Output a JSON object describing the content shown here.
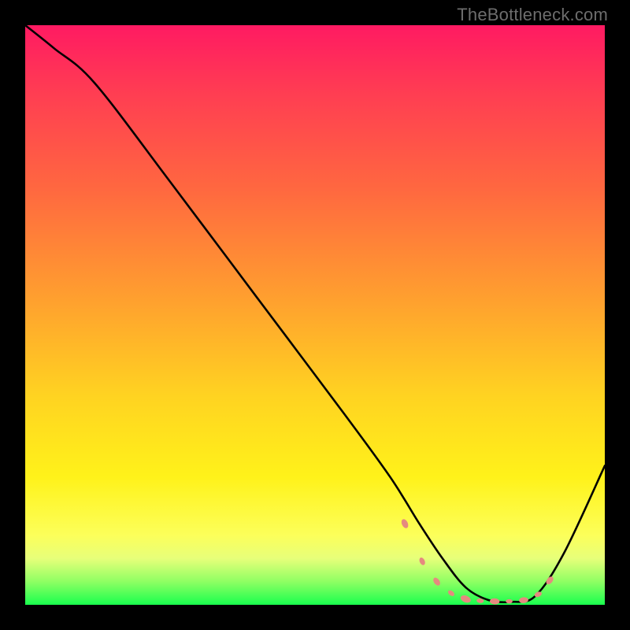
{
  "watermark": "TheBottleneck.com",
  "chart_data": {
    "type": "line",
    "title": "",
    "xlabel": "",
    "ylabel": "",
    "xlim": [
      0,
      100
    ],
    "ylim": [
      0,
      100
    ],
    "grid": false,
    "legend": false,
    "background": {
      "type": "vertical-gradient",
      "stops": [
        {
          "pos": 0,
          "color": "#ff1a62"
        },
        {
          "pos": 12,
          "color": "#ff3e52"
        },
        {
          "pos": 28,
          "color": "#ff6740"
        },
        {
          "pos": 48,
          "color": "#ffa22e"
        },
        {
          "pos": 64,
          "color": "#ffd321"
        },
        {
          "pos": 78,
          "color": "#fff21a"
        },
        {
          "pos": 88,
          "color": "#fcff5a"
        },
        {
          "pos": 92,
          "color": "#e7ff7a"
        },
        {
          "pos": 96,
          "color": "#8fff63"
        },
        {
          "pos": 100,
          "color": "#19ff4e"
        }
      ]
    },
    "series": [
      {
        "name": "bottleneck-curve",
        "color": "#000000",
        "x": [
          0,
          5,
          12,
          25,
          40,
          55,
          63,
          68,
          72,
          76,
          80,
          84,
          88,
          93,
          100
        ],
        "values": [
          100,
          96,
          90,
          73,
          53,
          33,
          22,
          14,
          8,
          3,
          0.8,
          0.5,
          1.5,
          9,
          24
        ]
      }
    ],
    "markers": {
      "name": "sweet-spot-dots",
      "color": "#e58a7f",
      "x": [
        65.5,
        68.5,
        71,
        73.5,
        76,
        78.5,
        81,
        83.5,
        86,
        88.5,
        90.5
      ],
      "values": [
        14,
        7.5,
        4,
        2,
        1,
        0.7,
        0.6,
        0.6,
        0.8,
        1.8,
        4.2
      ],
      "sizes": [
        4.5,
        3.8,
        4.2,
        3.4,
        5.0,
        3.4,
        4.6,
        3.2,
        4.4,
        3.6,
        4.2
      ]
    }
  }
}
